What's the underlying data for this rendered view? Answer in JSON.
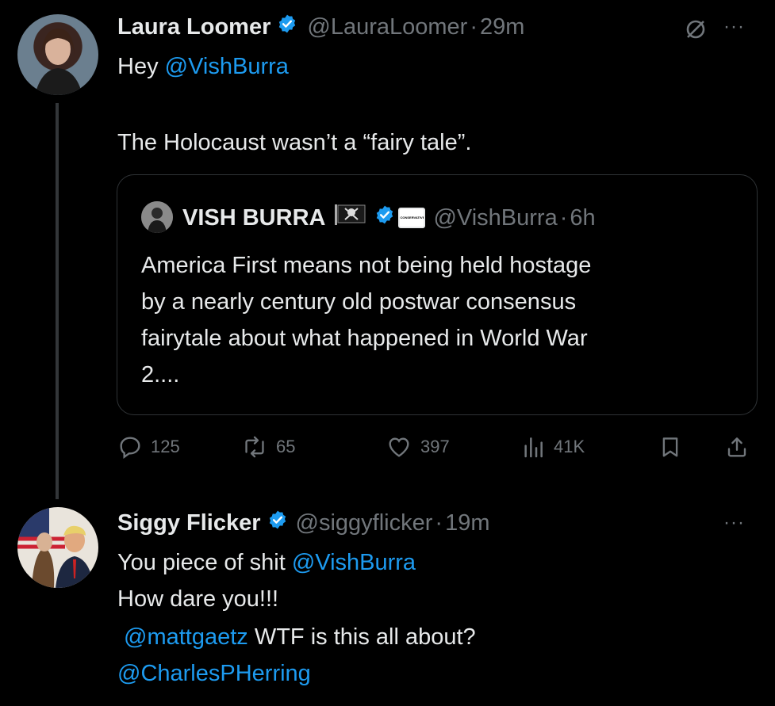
{
  "tweet1": {
    "name": "Laura Loomer",
    "handle": "@LauraLoomer",
    "sep": "·",
    "time": "29m",
    "line1_prefix": "Hey ",
    "line1_mention": "@VishBurra",
    "line2": "The Holocaust wasn’t a “fairy tale”.",
    "more": "···"
  },
  "quote": {
    "name": "VISH BURRA",
    "badge_text": "CONSERVATIVE",
    "handle": "@VishBurra",
    "sep": "·",
    "time": "6h",
    "lines": [
      "America First means not being held hostage",
      "by a nearly century old postwar consensus",
      "fairytale about what happened in World War",
      "2...."
    ]
  },
  "actions": {
    "replies": "125",
    "reposts": "65",
    "likes": "397",
    "views": "41K"
  },
  "tweet2": {
    "name": "Siggy Flicker",
    "handle": "@siggyflicker",
    "sep": "·",
    "time": "19m",
    "line1_prefix": "You piece of shit ",
    "line1_mention": "@VishBurra",
    "line2": "How dare you!!!",
    "line3_mention": "@mattgaetz",
    "line3_rest": " WTF is this all about?",
    "line4_mention": "@CharlesPHerring",
    "more": "···"
  },
  "colors": {
    "background": "#000000",
    "text": "#e7e9ea",
    "muted": "#71767b",
    "link": "#1d9bf0",
    "verified": "#1d9bf0",
    "border": "#2f3336"
  },
  "icons": {
    "verified": "verified-badge-icon",
    "grok": "no-symbol-icon",
    "reply": "reply-icon",
    "repost": "repost-icon",
    "like": "heart-icon",
    "views": "views-icon",
    "bookmark": "bookmark-icon",
    "share": "share-icon"
  }
}
